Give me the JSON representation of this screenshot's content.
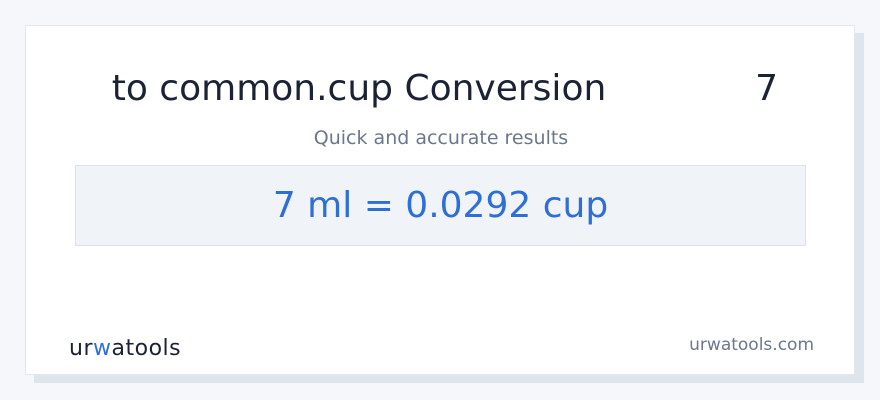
{
  "header": {
    "title": "to common.cup Conversion",
    "value": "7",
    "subtitle": "Quick and accurate results"
  },
  "result": {
    "text": "7 ml = 0.0292 cup"
  },
  "footer": {
    "logo_part1": "ur",
    "logo_accent": "w",
    "logo_part2": "atools",
    "site": "urwatools.com"
  },
  "colors": {
    "accent": "#2e6fd6",
    "title": "#1a2233",
    "muted": "#6b778c",
    "result_bg": "#f0f4f8"
  }
}
